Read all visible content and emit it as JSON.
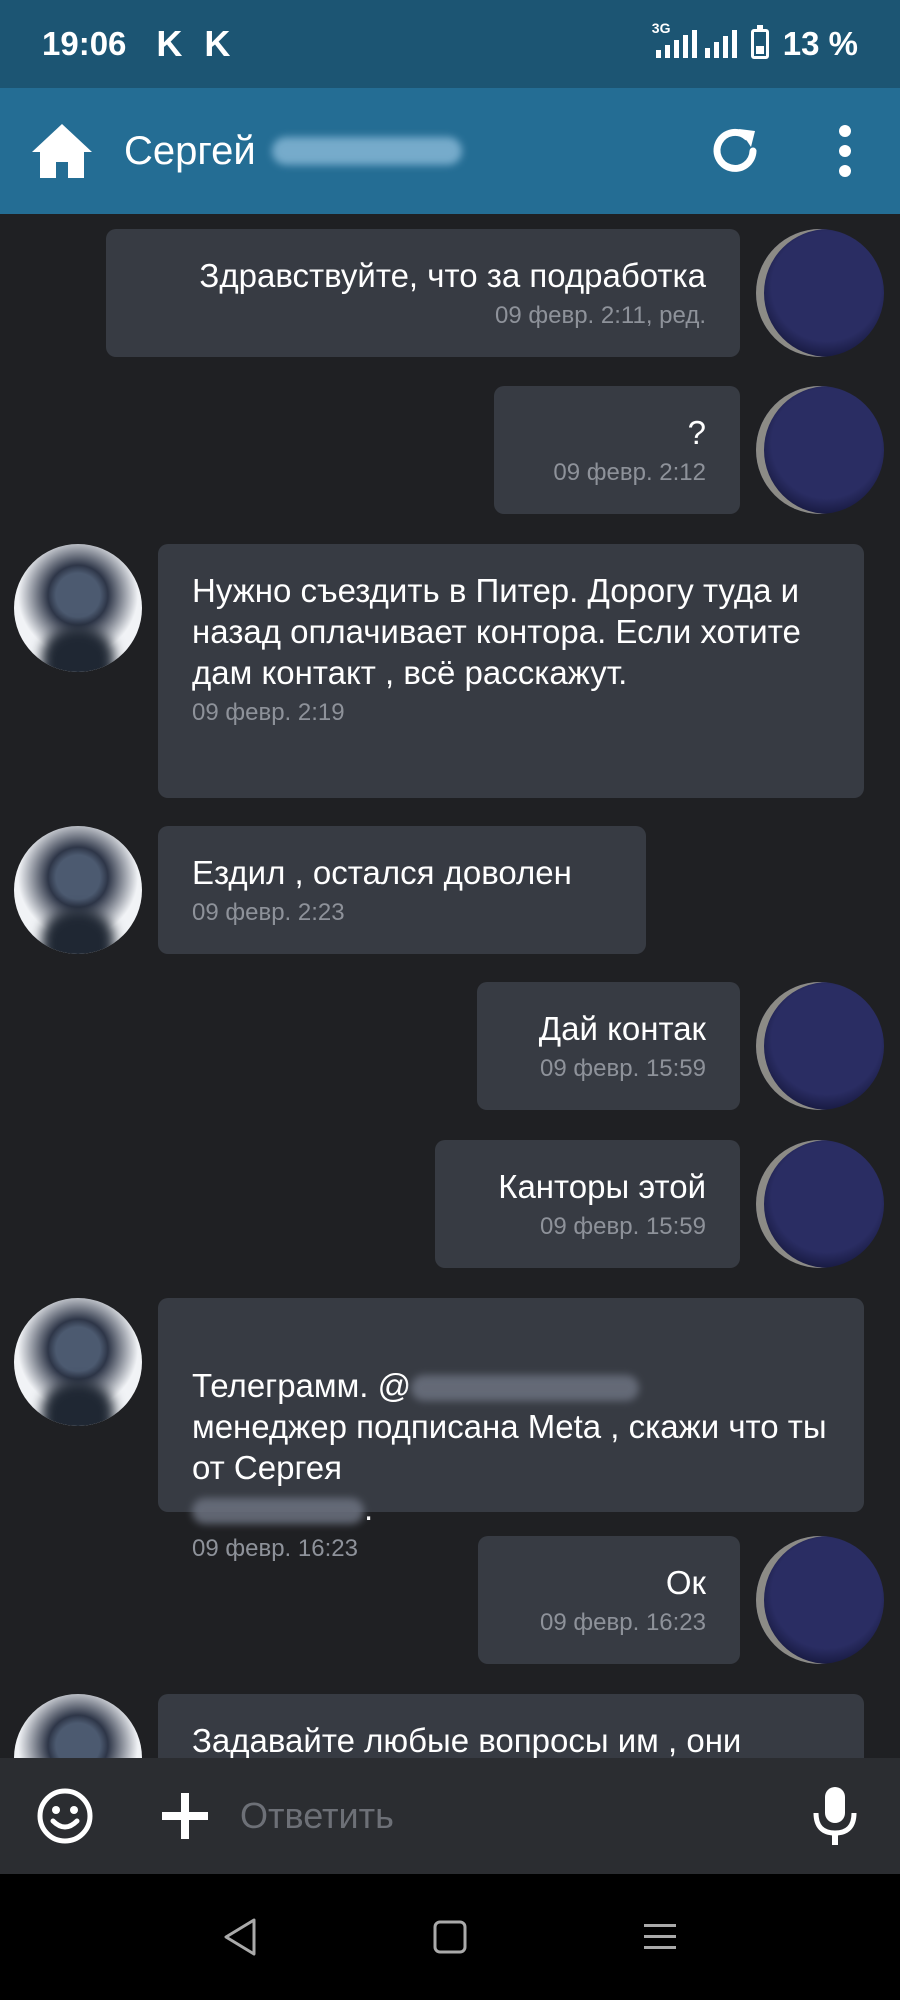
{
  "status": {
    "time": "19:06",
    "app_icons": [
      "K",
      "K"
    ],
    "network": "3G",
    "battery": "13 %"
  },
  "header": {
    "contact_name": "Сергей",
    "home_icon": "home-icon",
    "refresh_icon": "refresh-icon",
    "menu_icon": "more-vertical-icon"
  },
  "messages": [
    {
      "dir": "out",
      "text": "Здравствуйте, что за подработка",
      "time": "09 февр. 2:11, ред."
    },
    {
      "dir": "out",
      "text": "?",
      "time": "09 февр. 2:12"
    },
    {
      "dir": "in",
      "text": "Нужно съездить в Питер. Дорогу туда и назад оплачивает контора. Если хотите дам контакт , всё расскажут.",
      "time": "09 февр. 2:19"
    },
    {
      "dir": "in",
      "text": "Ездил , остался доволен",
      "time": "09 февр. 2:23"
    },
    {
      "dir": "out",
      "text": "Дай контак",
      "time": "09 февр. 15:59"
    },
    {
      "dir": "out",
      "text": "Канторы этой",
      "time": "09 февр. 15:59"
    },
    {
      "dir": "in",
      "text_parts": [
        "Телеграмм. @",
        "менеджер подписана Meta , скажи что ты от Сергея",
        "."
      ],
      "time": "09 февр. 16:23"
    },
    {
      "dir": "out",
      "text": "Ок",
      "time": "09 февр. 16:23"
    },
    {
      "dir": "in",
      "text": "Задавайте любые вопросы им , они",
      "time": ""
    }
  ],
  "input": {
    "placeholder": "Ответить",
    "emoji_icon": "emoji-icon",
    "attach_icon": "plus-icon",
    "mic_icon": "microphone-icon"
  },
  "navbar": {
    "back_icon": "back-triangle-icon",
    "home_icon": "home-square-icon",
    "recents_icon": "recents-lines-icon"
  },
  "colors": {
    "status_bar": "#1c5573",
    "header": "#246d94",
    "background": "#1f2023",
    "bubble": "#373b43",
    "timestamp": "#8e929a"
  }
}
